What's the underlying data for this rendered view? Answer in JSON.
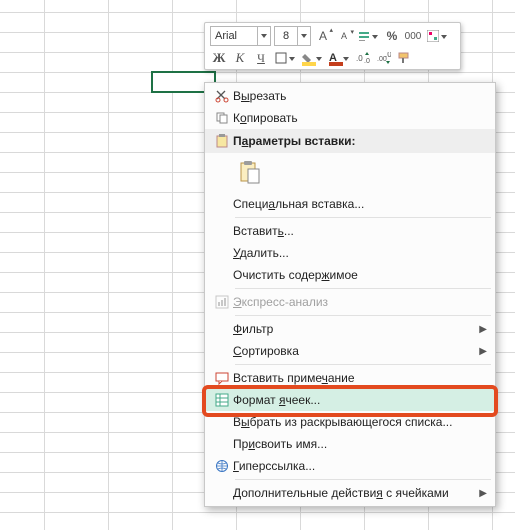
{
  "minibar": {
    "font": "Arial",
    "size": "8",
    "grow_label": "A",
    "shrink_label": "A",
    "percent": "%",
    "thousand": "000",
    "bold": "Ж",
    "italic": "К",
    "underline": "Ч"
  },
  "menu": {
    "cut": "Вырезать",
    "copy": "Копировать",
    "paste_header": "Параметры вставки:",
    "paste_special": "Специальная вставка...",
    "insert": "Вставить...",
    "delete": "Удалить...",
    "clear": "Очистить содержимое",
    "quick_analysis": "Экспресс-анализ",
    "filter": "Фильтр",
    "sort": "Сортировка",
    "insert_comment": "Вставить примечание",
    "format_cells": "Формат ячеек...",
    "pick_from_list": "Выбрать из раскрывающегося списка...",
    "define_name": "Присвоить имя...",
    "hyperlink": "Гиперссылка...",
    "more_actions": "Дополнительные действия с ячейками"
  },
  "accel": {
    "cut": "ы",
    "copy": "о",
    "paste_header": "а",
    "paste_special": "а",
    "insert": "ь",
    "delete": "У",
    "clear": "ж",
    "quick_analysis": "Э",
    "filter": "Ф",
    "sort": "С",
    "insert_comment": "ч",
    "format_cells": "я",
    "pick_from_list": "ы",
    "define_name": "и",
    "hyperlink": "Г",
    "more_actions": "я"
  }
}
